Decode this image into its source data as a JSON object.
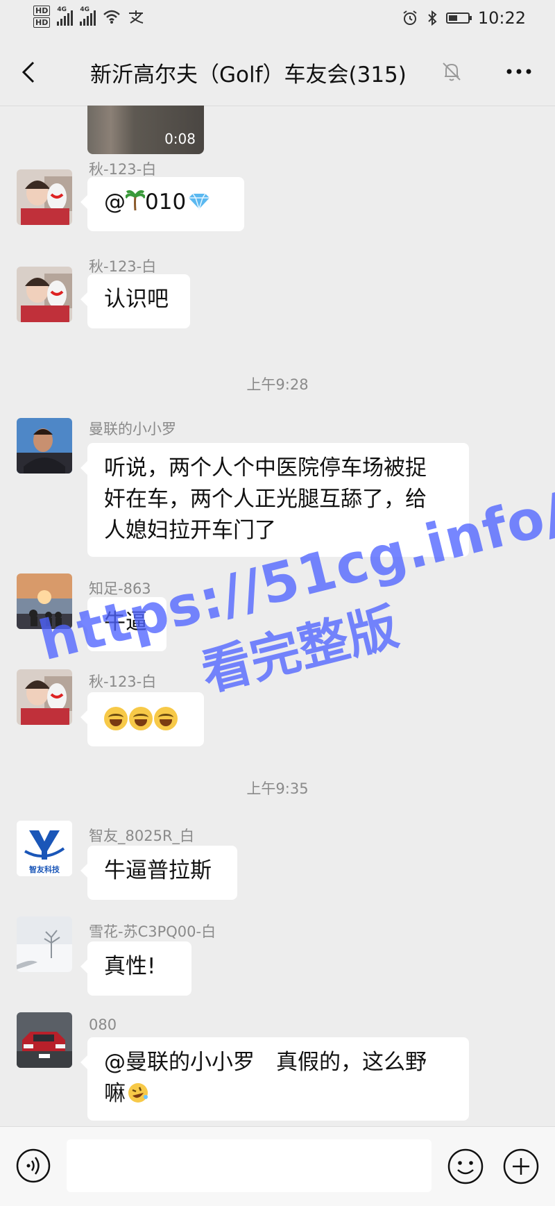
{
  "status_bar": {
    "hd1": "HD",
    "hd2": "HD",
    "net1": "4G",
    "net2": "4G",
    "time": "10:22",
    "battery_level": 0.45
  },
  "header": {
    "title": "新沂高尔夫（Golf）车友会(315)"
  },
  "chat": {
    "video_duration": "0:08",
    "messages": [
      {
        "sender": "秋-123-白",
        "text": "@",
        "text_after": "010"
      },
      {
        "sender": "秋-123-白",
        "text": "认识吧"
      },
      {
        "time": "上午9:28"
      },
      {
        "sender": "曼联的小小罗",
        "line1": "听说，两个人个中医院停车场被捉",
        "line2": "奸在车，两个人正光腿互舔了，给",
        "line3": "人媳妇拉开车门了"
      },
      {
        "sender": "知足-863",
        "text": "牛逼"
      },
      {
        "sender": "秋-123-白"
      },
      {
        "time": "上午9:35"
      },
      {
        "sender": "智友_8025R_白",
        "text": "牛逼普拉斯",
        "avatar_text": "智友科技"
      },
      {
        "sender": "雪花-苏C3PQ00-白",
        "text": "真性!"
      },
      {
        "sender": "080",
        "line1": "@曼联的小小罗　真假的，这么野",
        "line2": "嘛"
      }
    ]
  },
  "watermark": {
    "line1": "https://51cg.info/",
    "line2": "看完整版"
  },
  "colors": {
    "background": "#ededed",
    "bubble": "#ffffff",
    "watermark": "#5064ff"
  }
}
